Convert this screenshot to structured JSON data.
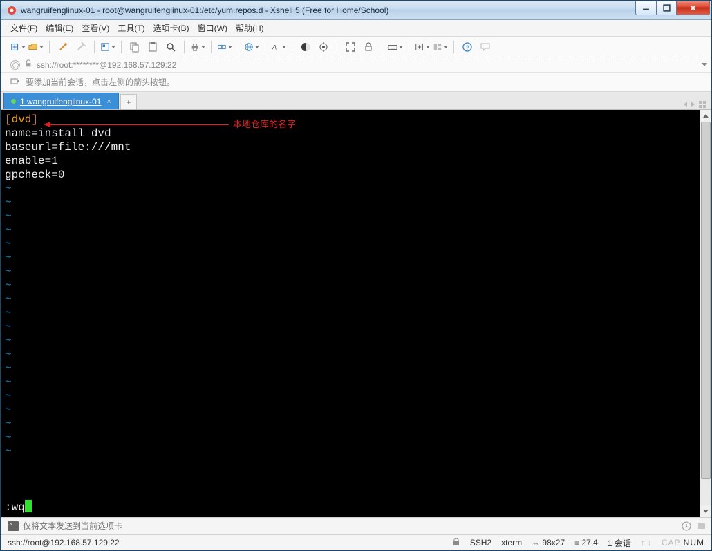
{
  "window": {
    "title": "wangruifenglinux-01 - root@wangruifenglinux-01:/etc/yum.repos.d - Xshell 5 (Free for Home/School)"
  },
  "menu": {
    "file": "文件(F)",
    "edit": "编辑(E)",
    "view": "查看(V)",
    "tools": "工具(T)",
    "tabs": "选项卡(B)",
    "window": "窗口(W)",
    "help": "帮助(H)"
  },
  "address": {
    "text": "ssh://root:********@192.168.57.129:22"
  },
  "hint": {
    "text": "要添加当前会话，点击左侧的箭头按钮。"
  },
  "tab": {
    "label": "1 wangruifenglinux-01",
    "new": "+"
  },
  "terminal": {
    "lines": [
      {
        "type": "section",
        "text": "[dvd]"
      },
      {
        "type": "plain",
        "text": "name=install dvd"
      },
      {
        "type": "plain",
        "text": "baseurl=file:///mnt"
      },
      {
        "type": "plain",
        "text": "enable=1"
      },
      {
        "type": "plain",
        "text": "gpcheck=0"
      }
    ],
    "command": ":wq",
    "annotation": "本地仓库的名字"
  },
  "input": {
    "placeholder": "仅将文本发送到当前选项卡"
  },
  "status": {
    "left": "ssh://root@192.168.57.129:22",
    "proto": "SSH2",
    "term": "xterm",
    "size": "98x27",
    "pos": "27,4",
    "sess": "1 会话",
    "capnum": {
      "cap": "CAP",
      "num": "NUM"
    },
    "sizeIcon": "⇔",
    "posIcon": "≡"
  },
  "icons": {
    "lock": "🔒"
  }
}
